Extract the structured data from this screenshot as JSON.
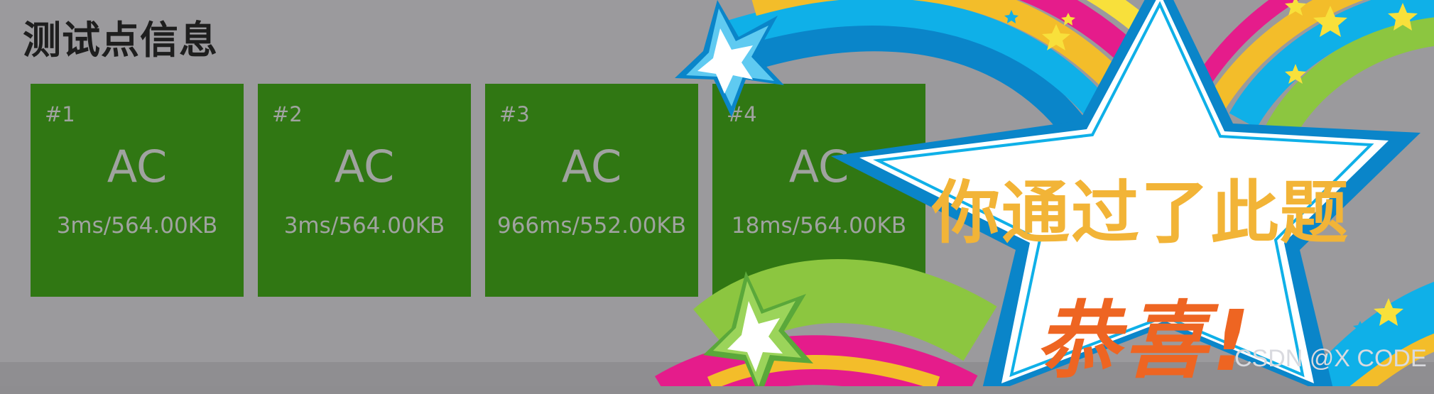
{
  "page": {
    "title": "测试点信息"
  },
  "test_cases": [
    {
      "id": "#1",
      "status": "AC",
      "stats": "3ms/564.00KB"
    },
    {
      "id": "#2",
      "status": "AC",
      "stats": "3ms/564.00KB"
    },
    {
      "id": "#3",
      "status": "AC",
      "stats": "966ms/552.00KB"
    },
    {
      "id": "#4",
      "status": "AC",
      "stats": "18ms/564.00KB"
    }
  ],
  "overlay": {
    "message": "你通过了此题",
    "congrats": "恭喜!"
  },
  "watermark": "CSDN @X CODE",
  "colors": {
    "accepted": "#307713",
    "banner_gold": "#f2b437",
    "banner_orange": "#ee6522"
  },
  "icons": [
    "star-icon"
  ]
}
